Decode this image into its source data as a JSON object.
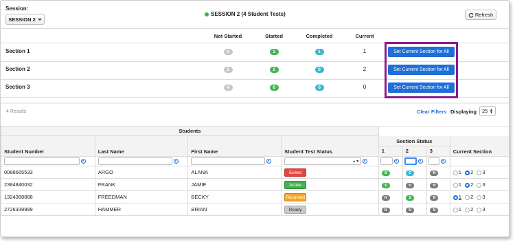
{
  "session": {
    "label": "Session:",
    "button": "SESSION 2",
    "status": "SESSION 2 (4 Student Tests)"
  },
  "toolbar": {
    "refresh": "Refresh"
  },
  "summary": {
    "headers": [
      "Not Started",
      "Started",
      "Completed",
      "Current"
    ],
    "set_button": "Set Current Section for All",
    "rows": [
      {
        "label": "Section 1",
        "not_started": "2",
        "started": "1",
        "completed": "1",
        "current": "1"
      },
      {
        "label": "Section 2",
        "not_started": "2",
        "started": "2",
        "completed": "0",
        "current": "2"
      },
      {
        "label": "Section 3",
        "not_started": "4",
        "started": "0",
        "completed": "0",
        "current": "0"
      }
    ]
  },
  "results": {
    "count": "4 Results",
    "clear_filters": "Clear Filters",
    "displaying_label": "Displaying",
    "displaying_value": "25"
  },
  "table": {
    "group_students": "Students",
    "group_section_status": "Section Status",
    "headers": [
      "Student Number",
      "Last Name",
      "First Name",
      "Student Test Status",
      "1",
      "2",
      "3",
      "Current Section"
    ],
    "radio_labels": [
      "1",
      "2",
      "3"
    ],
    "rows": [
      {
        "number": "0088665533",
        "last": "ARGO",
        "first": "ALANA",
        "status": "Exited",
        "s1": "S",
        "s2": "C",
        "s3": "N",
        "current": 2
      },
      {
        "number": "2384840032",
        "last": "FRANK",
        "first": "JAMIE",
        "status": "Active",
        "s1": "S",
        "s2": "N",
        "s3": "N",
        "current": 2
      },
      {
        "number": "1324388888",
        "last": "FREEDMAN",
        "first": "BECKY",
        "status": "Resumed",
        "s1": "N",
        "s2": "S",
        "s3": "N",
        "current": 1
      },
      {
        "number": "2726339999",
        "last": "HAMMER",
        "first": "BRIAN",
        "status": "Ready",
        "s1": "N",
        "s2": "N",
        "s3": "N",
        "current": 0
      }
    ]
  },
  "colors": {
    "accent": "#1f6fd8",
    "highlight": "#8a1b8a",
    "green": "#46b553",
    "red": "#e0483f",
    "orange": "#f5a623"
  }
}
